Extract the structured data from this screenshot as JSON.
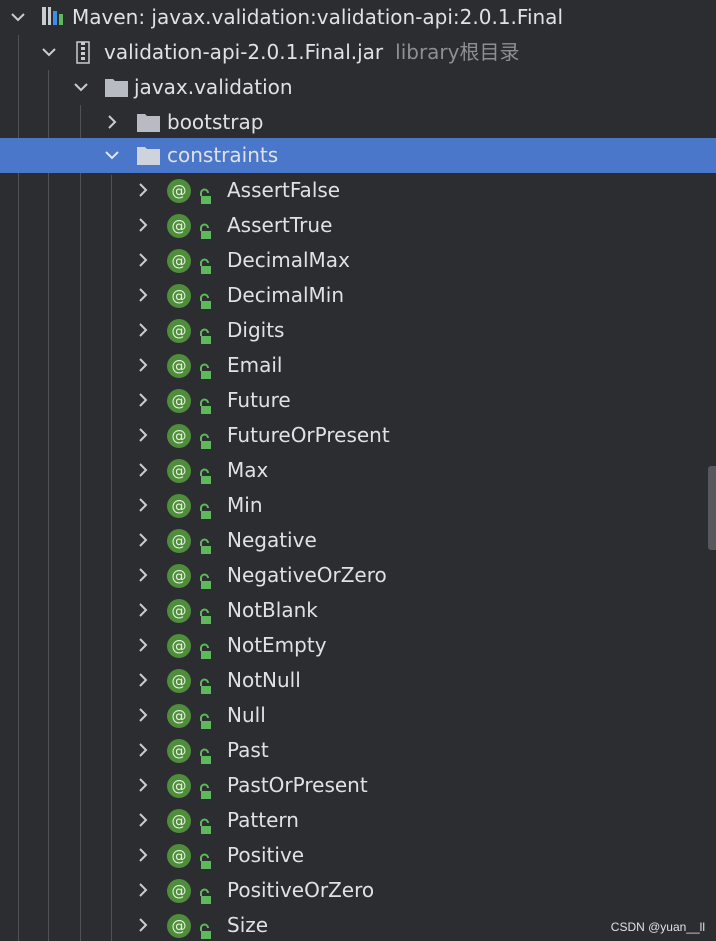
{
  "tree": {
    "root": {
      "label": "Maven: javax.validation:validation-api:2.0.1.Final",
      "icon": "maven-library-icon",
      "expanded": true
    },
    "jar": {
      "label": "validation-api-2.0.1.Final.jar",
      "sublabel": "library根目录",
      "icon": "jar-archive-icon",
      "expanded": true
    },
    "package_root": {
      "label": "javax.validation",
      "icon": "folder-icon",
      "expanded": true
    },
    "bootstrap": {
      "label": "bootstrap",
      "icon": "folder-icon",
      "expanded": false
    },
    "constraints": {
      "label": "constraints",
      "icon": "folder-icon",
      "expanded": true,
      "selected": true
    },
    "items": [
      {
        "label": "AssertFalse"
      },
      {
        "label": "AssertTrue"
      },
      {
        "label": "DecimalMax"
      },
      {
        "label": "DecimalMin"
      },
      {
        "label": "Digits"
      },
      {
        "label": "Email"
      },
      {
        "label": "Future"
      },
      {
        "label": "FutureOrPresent"
      },
      {
        "label": "Max"
      },
      {
        "label": "Min"
      },
      {
        "label": "Negative"
      },
      {
        "label": "NegativeOrZero"
      },
      {
        "label": "NotBlank"
      },
      {
        "label": "NotEmpty"
      },
      {
        "label": "NotNull"
      },
      {
        "label": "Null"
      },
      {
        "label": "Past"
      },
      {
        "label": "PastOrPresent"
      },
      {
        "label": "Pattern"
      },
      {
        "label": "Positive"
      },
      {
        "label": "PositiveOrZero"
      },
      {
        "label": "Size"
      }
    ],
    "item_icon": "annotation-icon",
    "item_glyph": "@",
    "item_modifier_icon": "public-lock-icon"
  },
  "watermark": "CSDN @yuan__ll",
  "colors": {
    "background": "#2b2d30",
    "selection": "#4a77c9",
    "annotation": "#4e8d3a",
    "sublabel": "#8c8f94"
  }
}
